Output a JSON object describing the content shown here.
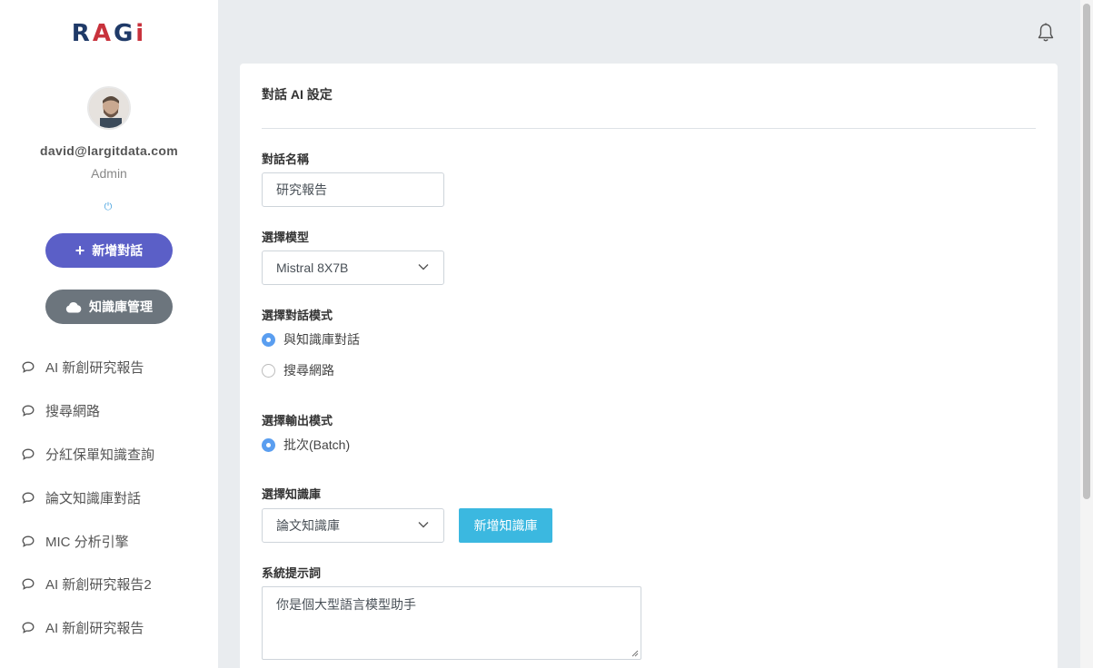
{
  "logo": {
    "r": "R",
    "a": "A",
    "g": "G",
    "i": "i"
  },
  "user": {
    "email": "david@largitdata.com",
    "role": "Admin"
  },
  "sidebar": {
    "new_chat_label": "新增對話",
    "kb_manage_label": "知識庫管理",
    "items": [
      {
        "label": "AI 新創研究報告"
      },
      {
        "label": "搜尋網路"
      },
      {
        "label": "分紅保單知識查詢"
      },
      {
        "label": "論文知識庫對話"
      },
      {
        "label": "MIC 分析引擎"
      },
      {
        "label": "AI 新創研究報告2"
      },
      {
        "label": "AI 新創研究報告"
      }
    ]
  },
  "form": {
    "title": "對話 AI 設定",
    "name_label": "對話名稱",
    "name_value": "研究報告",
    "model_label": "選擇模型",
    "model_value": "Mistral 8X7B",
    "mode_label": "選擇對話模式",
    "mode_options": [
      "與知識庫對話",
      "搜尋網路"
    ],
    "output_label": "選擇輸出模式",
    "output_options": [
      "批次(Batch)"
    ],
    "kb_label": "選擇知識庫",
    "kb_value": "論文知識庫",
    "add_kb_label": "新增知識庫",
    "prompt_label": "系統提示詞",
    "prompt_value": "你是個大型語言模型助手"
  },
  "colors": {
    "primary": "#5b5fc7",
    "secondary": "#6c757d",
    "info": "#3bb8e0",
    "radio_checked": "#5a9ef0"
  }
}
